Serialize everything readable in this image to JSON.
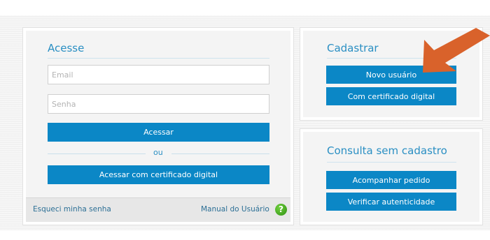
{
  "login": {
    "title": "Acesse",
    "email_placeholder": "Email",
    "password_placeholder": "Senha",
    "submit_label": "Acessar",
    "or_label": "ou",
    "certificate_label": "Acessar com certificado digital",
    "forgot_password_label": "Esqueci minha senha",
    "manual_label": "Manual do Usuário",
    "help_icon": "question-circle-icon"
  },
  "register": {
    "title": "Cadastrar",
    "new_user_label": "Novo usuário",
    "certificate_label": "Com certificado digital"
  },
  "lookup": {
    "title": "Consulta sem cadastro",
    "track_label": "Acompanhar pedido",
    "verify_label": "Verificar autenticidade"
  },
  "annotation": {
    "arrow_icon": "pointer-arrow-icon",
    "arrow_color": "#d9622b"
  },
  "colors": {
    "accent": "#0b87c6",
    "title": "#2a8fc3",
    "help_icon": "#3aa21c"
  }
}
